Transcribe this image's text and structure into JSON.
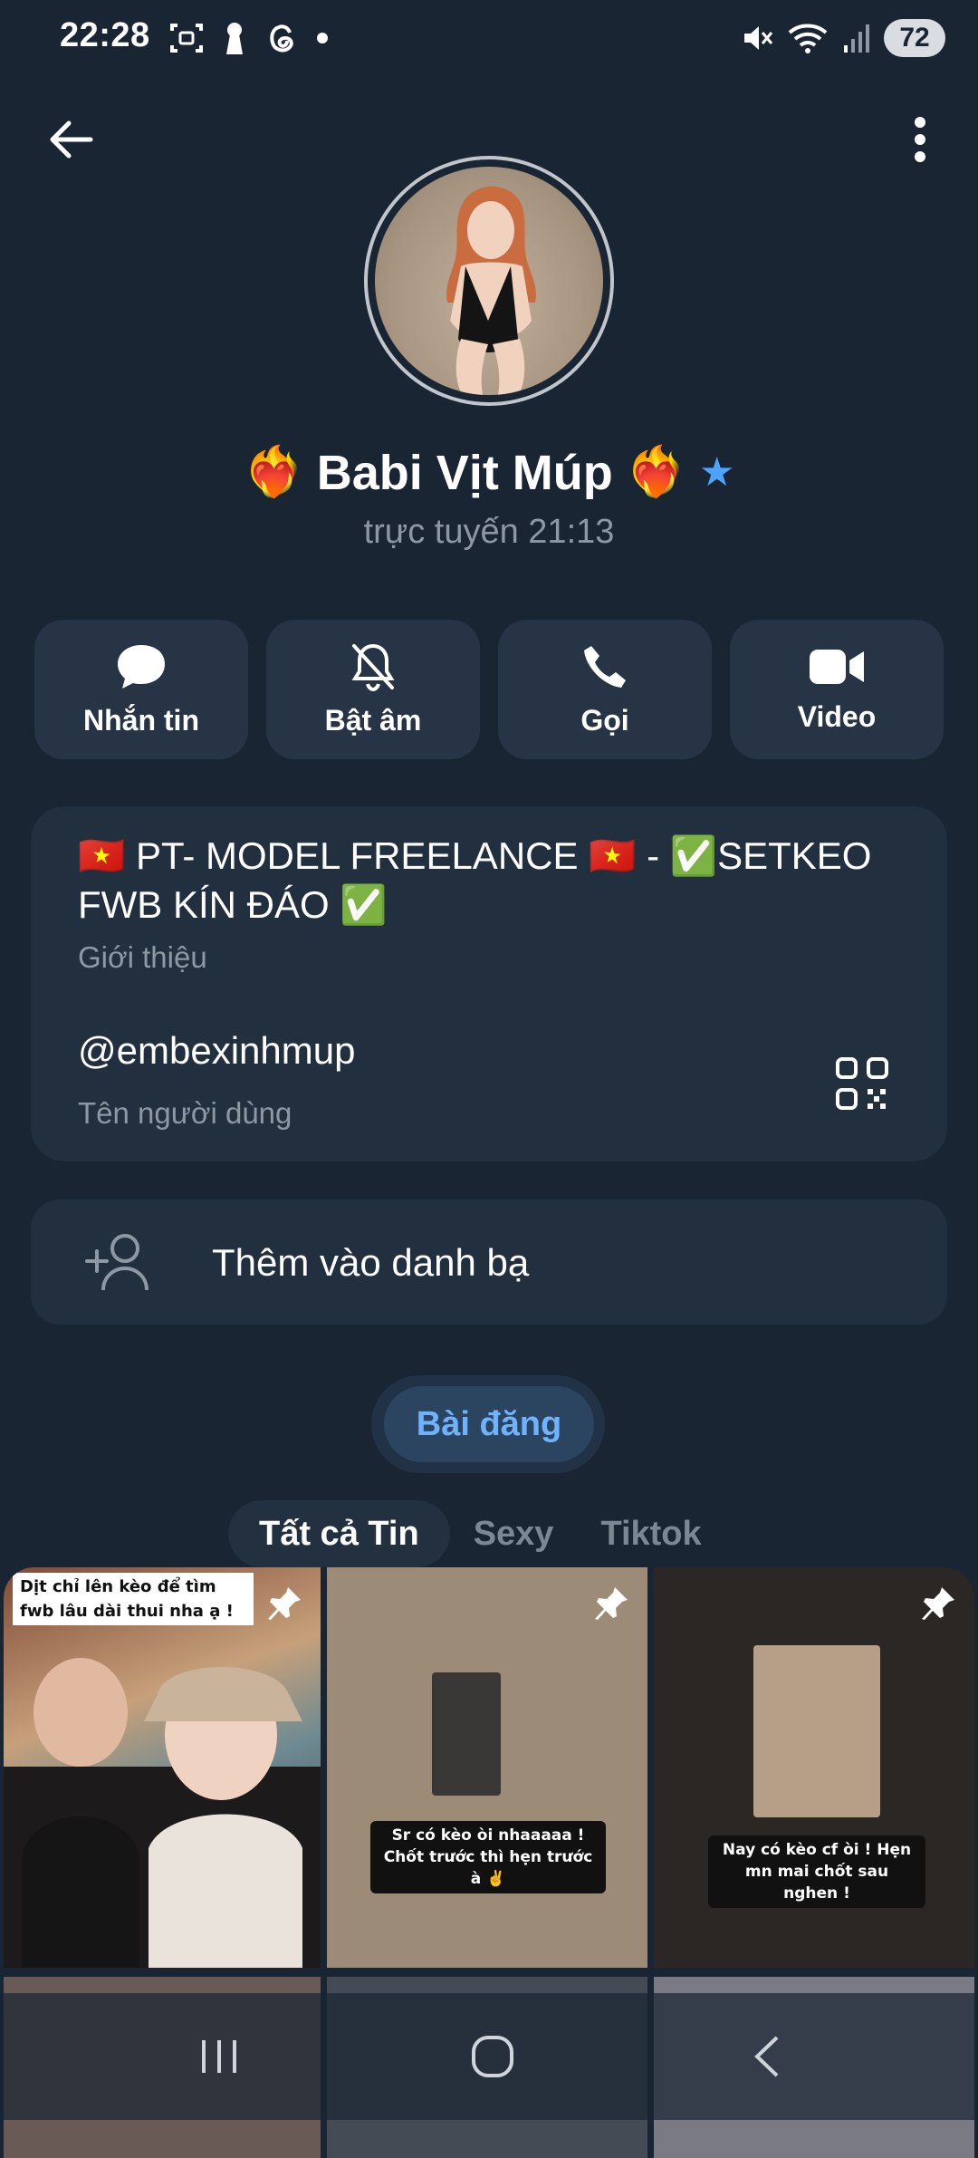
{
  "status_bar": {
    "time": "22:28",
    "battery": "72",
    "icons": [
      "screenshot-icon",
      "keyhole-icon",
      "threads-icon",
      "notification-dot",
      "mute-icon",
      "wifi-icon",
      "signal-icon"
    ]
  },
  "profile": {
    "name": "Babi Vịt Múp",
    "name_prefix_emoji": "❤️‍🔥",
    "name_suffix_emoji": "❤️‍🔥",
    "premium_star": "★",
    "status": "trực tuyến 21:13"
  },
  "actions": [
    {
      "label": "Nhắn tin",
      "icon": "message-icon"
    },
    {
      "label": "Bật âm",
      "icon": "bell-off-icon"
    },
    {
      "label": "Gọi",
      "icon": "phone-icon"
    },
    {
      "label": "Video",
      "icon": "video-icon"
    }
  ],
  "info": {
    "bio": "🇻🇳 PT- MODEL FREELANCE 🇻🇳 - ✅SETKEO FWB KÍN ĐÁO ✅",
    "bio_label": "Giới thiệu",
    "username": "@embexinhmup",
    "username_label": "Tên người dùng"
  },
  "add_contact": {
    "label": "Thêm vào danh bạ"
  },
  "posts_tab": "Bài đăng",
  "filter_tabs": [
    {
      "label": "Tất cả Tin",
      "active": true
    },
    {
      "label": "Sexy",
      "active": false
    },
    {
      "label": "Tiktok",
      "active": false
    }
  ],
  "stories": [
    {
      "caption": "Dịt chỉ lên kèo để tìm fwb lâu dài thui nha ạ !",
      "pinned": true
    },
    {
      "caption": "Sr có kèo òi nhaaaaa ! Chốt trước thì hẹn trước à ✌️",
      "pinned": true
    },
    {
      "caption": "Nay có kèo cf òi ! Hẹn mn mai chốt sau nghen !",
      "pinned": true
    }
  ],
  "colors": {
    "background": "#1a2533",
    "card": "#222f3e",
    "accent": "#6fb3ff",
    "muted_text": "#8e98a4"
  }
}
